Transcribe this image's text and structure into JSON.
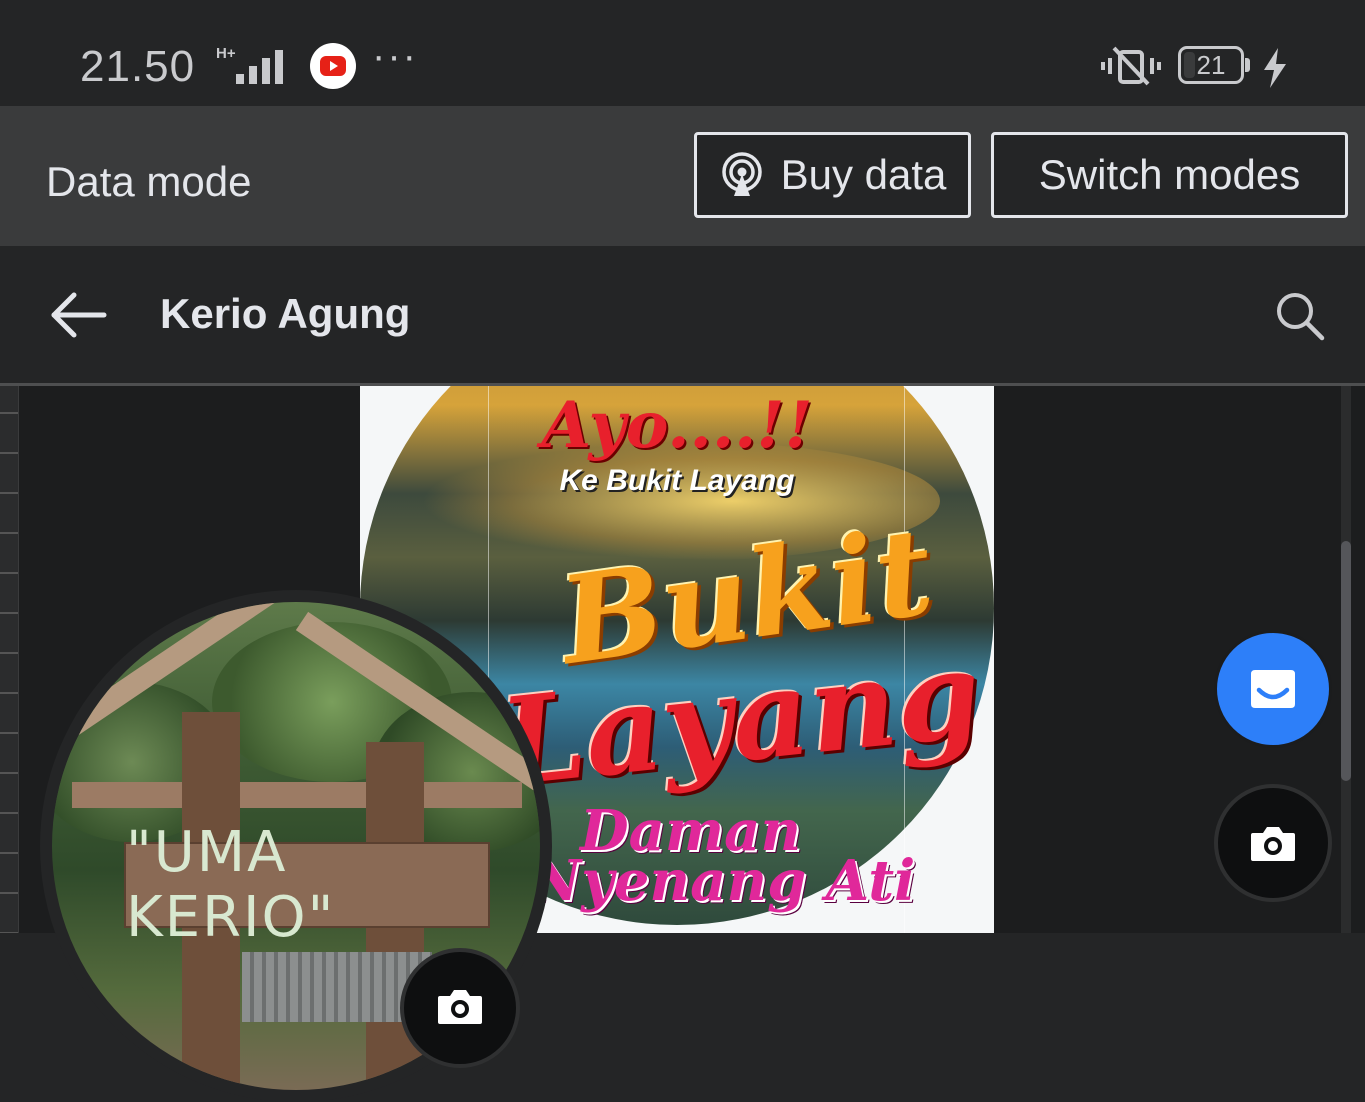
{
  "status_bar": {
    "time": "21.50",
    "network_type": "H+",
    "notification_app": "youtube-icon",
    "more_indicator": "···",
    "battery_percent": "21",
    "battery_level": 0.21,
    "charging": true
  },
  "data_mode_bar": {
    "title": "Data mode",
    "buy_label": "Buy data",
    "switch_label": "Switch modes"
  },
  "header": {
    "title": "Kerio Agung",
    "back_icon": "arrow-left-icon",
    "search_icon": "search-icon"
  },
  "cover_photo": {
    "text_line1": "Ayo....!!",
    "text_line2": "Ke Bukit Layang",
    "text_line3": "Bukit",
    "text_line4": "Layang",
    "text_line5": "Daman",
    "text_line6": "Nyenang Ati"
  },
  "profile_photo": {
    "sign_text": "\"UMA KERIO\""
  },
  "fabs": {
    "messenger_icon": "messenger-icon",
    "camera_icon": "camera-icon"
  },
  "colors": {
    "background": "#242526",
    "bar": "#3a3b3c",
    "accent_blue": "#2d7ff9",
    "text": "#e4e6eb"
  }
}
